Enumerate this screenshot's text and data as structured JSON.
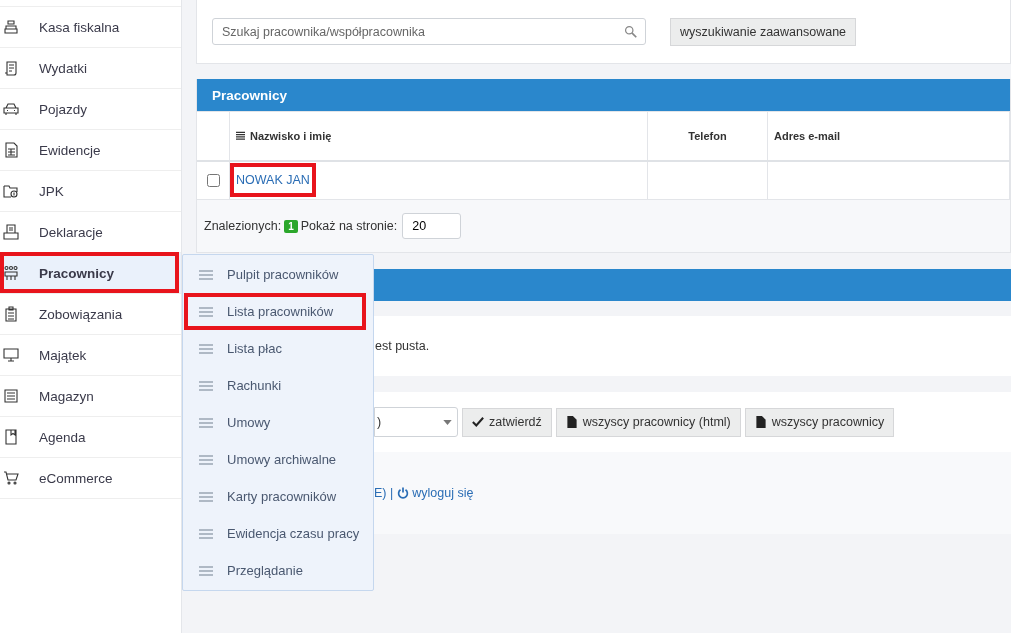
{
  "sidebar": {
    "items": [
      {
        "label": "Kasa fiskalna",
        "selected": false,
        "annotated": false
      },
      {
        "label": "Wydatki",
        "selected": false,
        "annotated": false
      },
      {
        "label": "Pojazdy",
        "selected": false,
        "annotated": false
      },
      {
        "label": "Ewidencje",
        "selected": false,
        "annotated": false
      },
      {
        "label": "JPK",
        "selected": false,
        "annotated": false
      },
      {
        "label": "Deklaracje",
        "selected": false,
        "annotated": false
      },
      {
        "label": "Pracownicy",
        "selected": true,
        "annotated": true
      },
      {
        "label": "Zobowiązania",
        "selected": false,
        "annotated": false
      },
      {
        "label": "Majątek",
        "selected": false,
        "annotated": false
      },
      {
        "label": "Magazyn",
        "selected": false,
        "annotated": false
      },
      {
        "label": "Agenda",
        "selected": false,
        "annotated": false
      },
      {
        "label": "eCommerce",
        "selected": false,
        "annotated": false
      }
    ]
  },
  "search": {
    "placeholder": "Szukaj pracownika/współpracownika",
    "advanced_button": "wyszukiwanie zaawansowane"
  },
  "employees_panel": {
    "title": "Pracownicy",
    "columns": [
      "Nazwisko i imię",
      "Telefon",
      "Adres e-mail"
    ],
    "rows": [
      {
        "checked": false,
        "name": "NOWAK JAN",
        "annotated": true
      }
    ],
    "found_label": "Znalezionych:",
    "found_count": "1",
    "per_page_label": "Pokaż na stronie:",
    "per_page": "20"
  },
  "second_panel": {
    "message": "est pusta."
  },
  "actions": {
    "select_value": ")",
    "buttons": [
      {
        "label": "zatwierdź",
        "kind": "confirm"
      },
      {
        "label": "wszyscy pracownicy (html)",
        "kind": "file"
      },
      {
        "label": "wszyscy pracownicy",
        "kind": "file"
      }
    ]
  },
  "footer": {
    "text": "E) |",
    "logout": "wyloguj się"
  },
  "submenu": {
    "items": [
      {
        "label": "Pulpit pracowników",
        "selected": false,
        "annotated": false
      },
      {
        "label": "Lista pracowników",
        "selected": false,
        "annotated": true
      },
      {
        "label": "Lista płac",
        "selected": false,
        "annotated": false
      },
      {
        "label": "Rachunki",
        "selected": false,
        "annotated": false
      },
      {
        "label": "Umowy",
        "selected": false,
        "annotated": false
      },
      {
        "label": "Umowy archiwalne",
        "selected": false,
        "annotated": false
      },
      {
        "label": "Karty pracowników",
        "selected": false,
        "annotated": false
      },
      {
        "label": "Ewidencja czasu pracy",
        "selected": false,
        "annotated": false
      },
      {
        "label": "Przeglądanie",
        "selected": false,
        "annotated": false
      }
    ]
  }
}
